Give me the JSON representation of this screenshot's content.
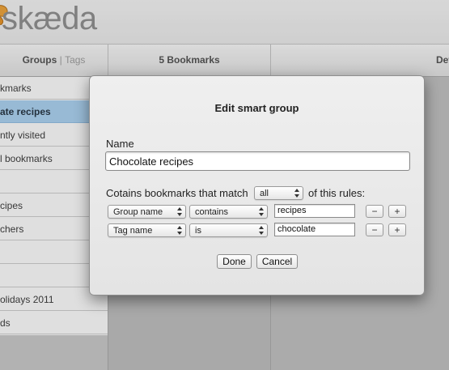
{
  "app": {
    "logo_text": "skæda",
    "logo_icon": "butterfly-icon"
  },
  "columns": {
    "groups_label": "Groups",
    "separator": "|",
    "tags_label": "Tags",
    "bookmarks_label": "5 Bookmarks",
    "detail_label": "Deta"
  },
  "groups": [
    {
      "label": "kmarks"
    },
    {
      "label": "ate recipes",
      "selected": true
    },
    {
      "label": "ntly visited"
    },
    {
      "label": "l bookmarks"
    },
    {
      "label": ""
    },
    {
      "label": "cipes"
    },
    {
      "label": "chers"
    },
    {
      "label": ""
    },
    {
      "label": ""
    },
    {
      "label": "olidays 2011"
    },
    {
      "label": "ds"
    }
  ],
  "dialog": {
    "title": "Edit smart group",
    "name_label": "Name",
    "name_value": "Chocolate recipes",
    "match_prefix": "Cotains bookmarks that match",
    "match_value": "all",
    "match_suffix": "of this rules:",
    "rules": [
      {
        "field": "Group name",
        "operator": "contains",
        "value": "recipes"
      },
      {
        "field": "Tag name",
        "operator": "is",
        "value": "chocolate"
      }
    ],
    "minus_label": "−",
    "plus_label": "+",
    "done_label": "Done",
    "cancel_label": "Cancel"
  },
  "colors": {
    "selection": "#a9d2f3",
    "logo": "#8b8b8b",
    "logo_accent": "#f0a030"
  }
}
